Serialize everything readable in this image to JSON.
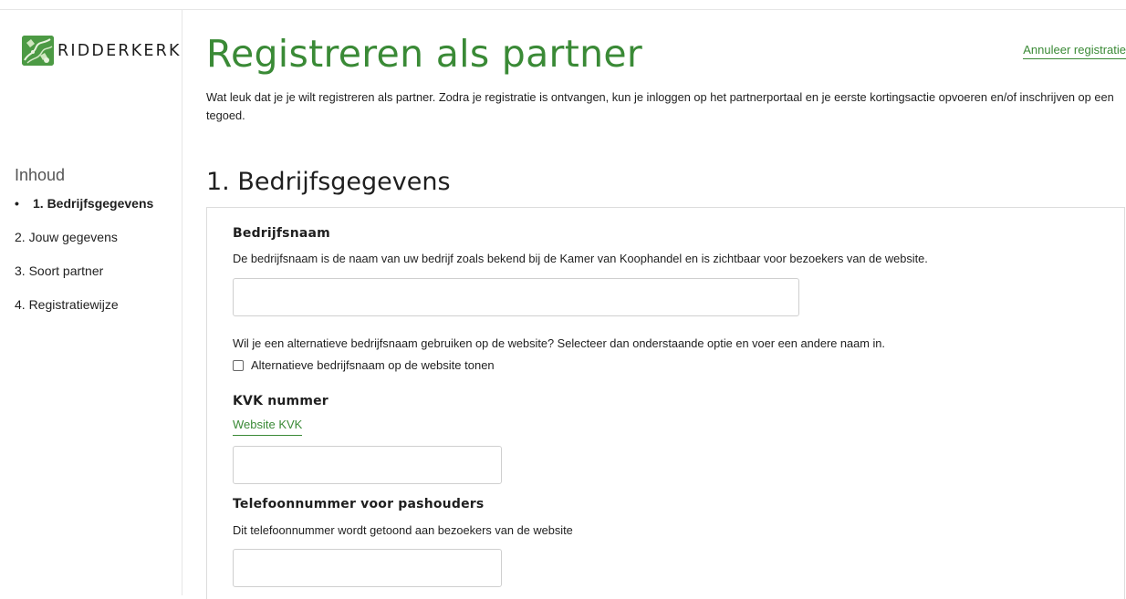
{
  "brand": {
    "name": "RIDDERKERK",
    "accent": "#3a8a36"
  },
  "sidebar": {
    "toc_title": "Inhoud",
    "items": [
      {
        "label": "1. Bedrijfsgegevens",
        "active": true
      },
      {
        "label": "2. Jouw gegevens"
      },
      {
        "label": "3. Soort partner"
      },
      {
        "label": "4. Registratiewijze"
      }
    ]
  },
  "header": {
    "title": "Registreren als partner",
    "cancel_link": "Annuleer registratie",
    "intro": "Wat leuk dat je je wilt registreren als partner. Zodra je registratie is ontvangen, kun je inloggen op het partnerportaal en je eerste kortingsactie opvoeren en/of inschrijven op een tegoed."
  },
  "section": {
    "title": "1. Bedrijfsgegevens",
    "company_name": {
      "label": "Bedrijfsnaam",
      "help": "De bedrijfsnaam is de naam van uw bedrijf zoals bekend bij de Kamer van Koophandel en is zichtbaar voor bezoekers van de website.",
      "value": "",
      "placeholder": ""
    },
    "alt_name": {
      "help": "Wil je een alternatieve bedrijfsnaam gebruiken op de website? Selecteer dan onderstaande optie en voer een andere naam in.",
      "checkbox_label": "Alternatieve bedrijfsnaam op de website tonen",
      "checked": false
    },
    "kvk": {
      "label": "KVK nummer",
      "link": "Website KVK",
      "value": "",
      "placeholder": ""
    },
    "phone": {
      "label": "Telefoonnummer voor pashouders",
      "help": "Dit telefoonnummer wordt getoond aan bezoekers van de website",
      "value": "",
      "placeholder": ""
    }
  }
}
